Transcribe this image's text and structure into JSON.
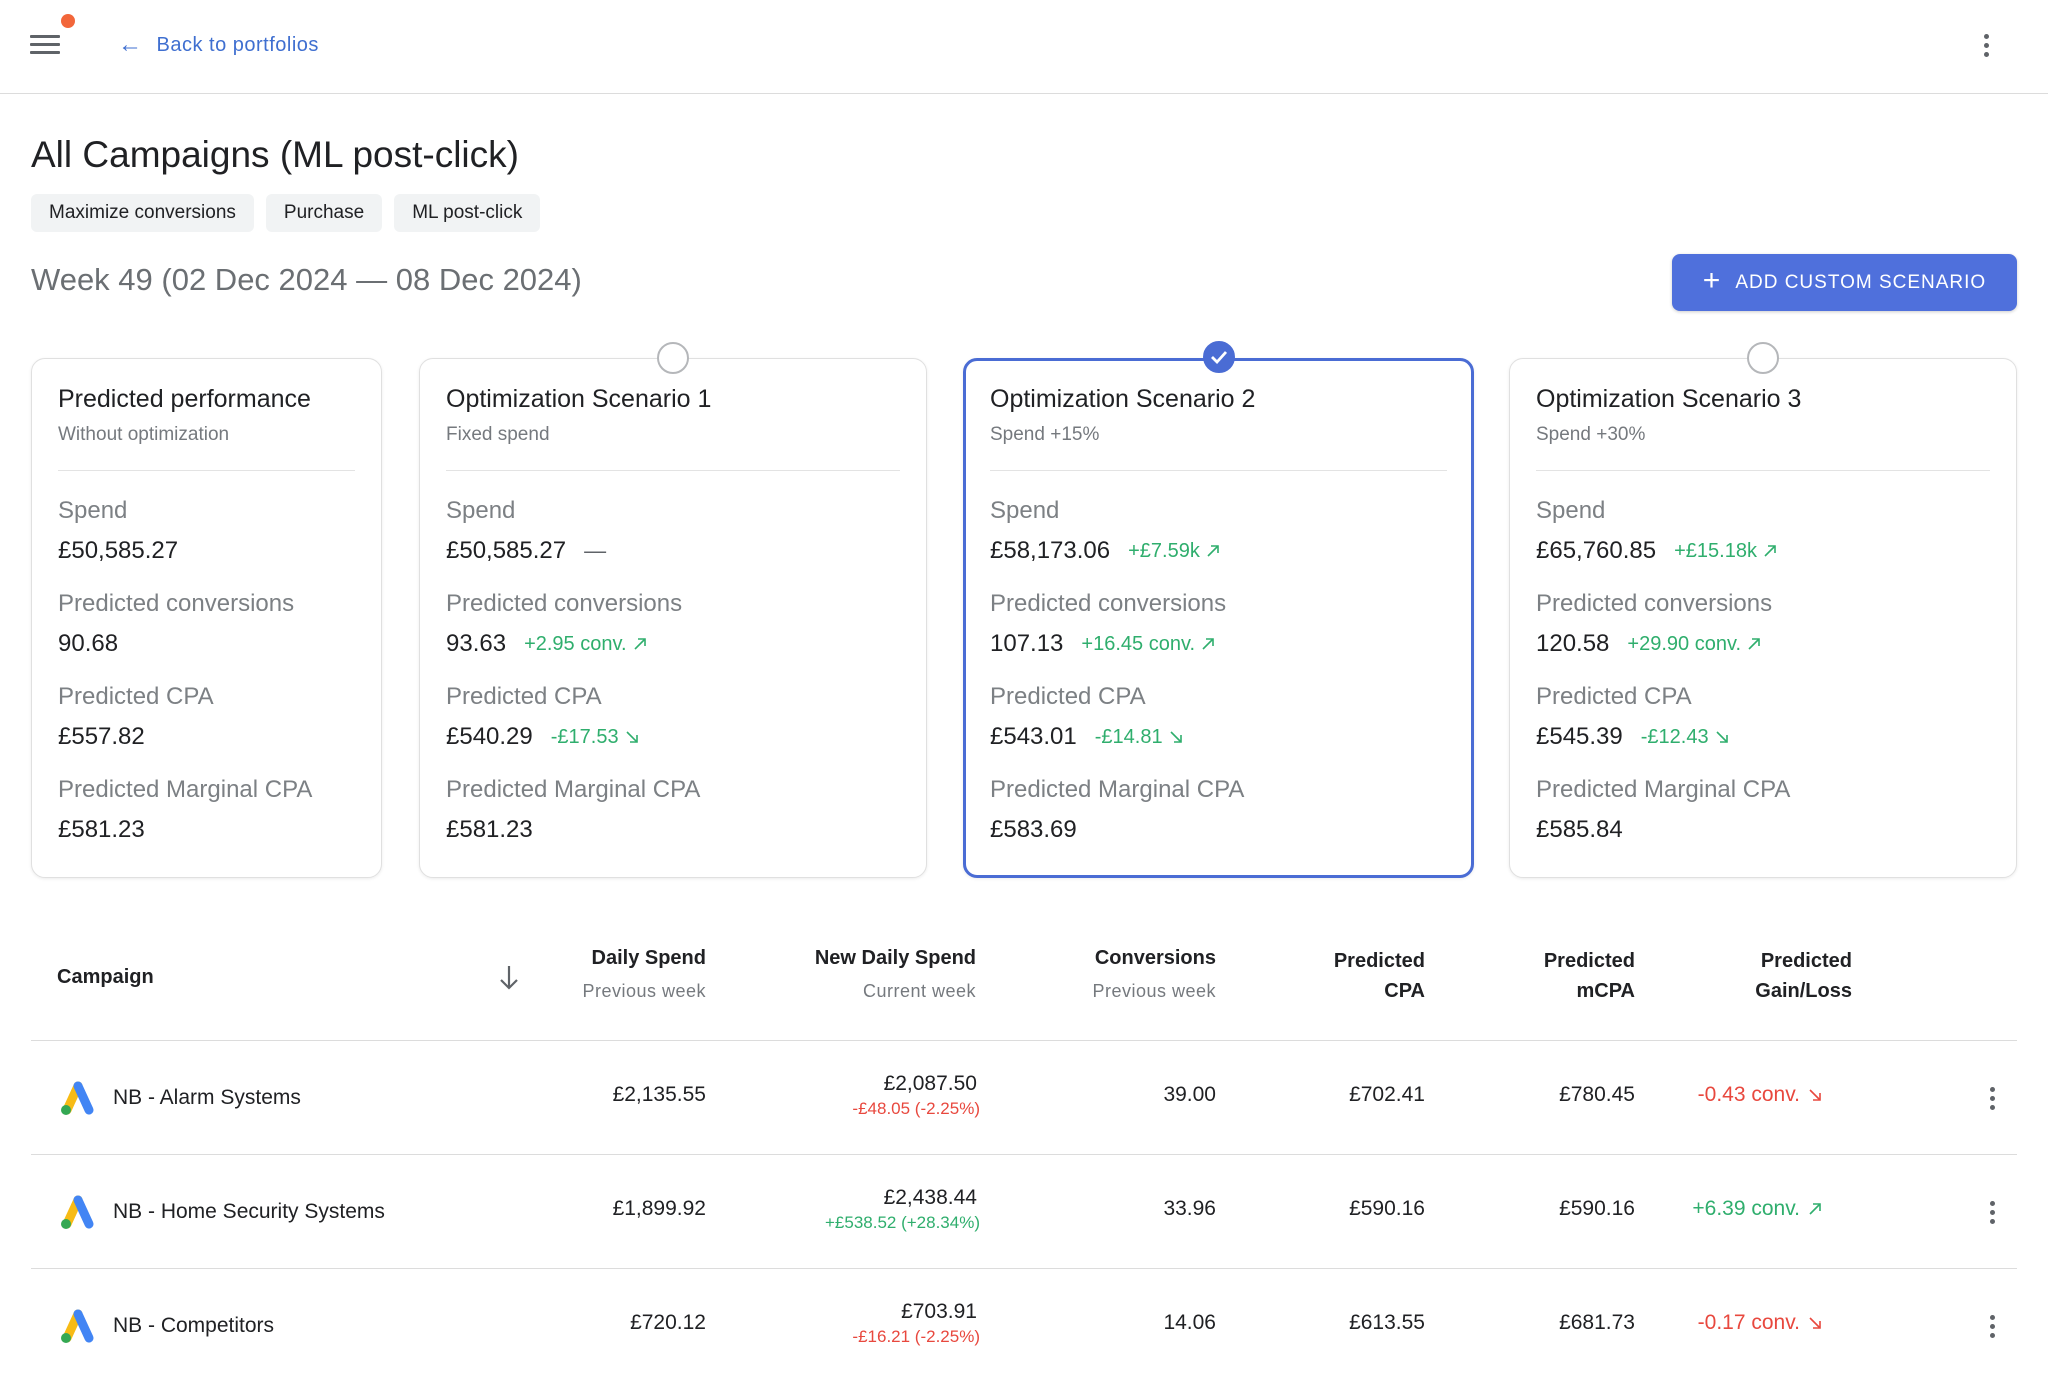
{
  "topbar": {
    "menu_icon": "hamburger-menu-icon",
    "notification_color": "#f2663a",
    "back_label": "Back to portfolios",
    "back_icon": "arrow-left-icon",
    "more_icon": "more-vertical-icon"
  },
  "header": {
    "title": "All Campaigns (ML post-click)",
    "chips": [
      "Maximize conversions",
      "Purchase",
      "ML post-click"
    ],
    "week": "Week 49 (02 Dec 2024 — 08 Dec 2024)",
    "add_button": "ADD CUSTOM SCENARIO",
    "add_button_color": "#4f70dc"
  },
  "labels": {
    "spend": "Spend",
    "conversions": "Predicted conversions",
    "cpa": "Predicted CPA",
    "marginal_cpa": "Predicted Marginal CPA"
  },
  "cards": [
    {
      "title": "Predicted performance",
      "subtitle": "Without optimization",
      "spend": "£50,585.27",
      "spend_delta": "",
      "conversions": "90.68",
      "conversions_delta": "",
      "cpa": "£557.82",
      "cpa_delta": "",
      "marginal_cpa": "£581.23",
      "selectable": false,
      "selected": false
    },
    {
      "title": "Optimization Scenario 1",
      "subtitle": "Fixed spend",
      "spend": "£50,585.27",
      "spend_delta": "—",
      "conversions": "93.63",
      "conversions_delta": "+2.95 conv.",
      "cpa": "£540.29",
      "cpa_delta": "-£17.53",
      "marginal_cpa": "£581.23",
      "selectable": true,
      "selected": false
    },
    {
      "title": "Optimization Scenario 2",
      "subtitle": "Spend +15%",
      "spend": "£58,173.06",
      "spend_delta": "+£7.59k",
      "conversions": "107.13",
      "conversions_delta": "+16.45 conv.",
      "cpa": "£543.01",
      "cpa_delta": "-£14.81",
      "marginal_cpa": "£583.69",
      "selectable": true,
      "selected": true
    },
    {
      "title": "Optimization Scenario 3",
      "subtitle": "Spend +30%",
      "spend": "£65,760.85",
      "spend_delta": "+£15.18k",
      "conversions": "120.58",
      "conversions_delta": "+29.90 conv.",
      "cpa": "£545.39",
      "cpa_delta": "-£12.43",
      "marginal_cpa": "£585.84",
      "selectable": true,
      "selected": false
    }
  ],
  "table": {
    "headers": {
      "campaign": "Campaign",
      "daily_spend": "Daily Spend",
      "daily_spend_sub": "Previous week",
      "new_daily_spend": "New Daily Spend",
      "new_daily_spend_sub": "Current week",
      "conversions": "Conversions",
      "conversions_sub": "Previous week",
      "predicted_cpa_1": "Predicted",
      "predicted_cpa_2": "CPA",
      "predicted_mcpa_1": "Predicted",
      "predicted_mcpa_2": "mCPA",
      "gain_1": "Predicted",
      "gain_2": "Gain/Loss"
    },
    "sort_icon": "arrow-down-icon",
    "rows": [
      {
        "name": "NB - Alarm Systems",
        "daily_spend": "£2,135.55",
        "new_daily_spend": "£2,087.50",
        "new_daily_spend_change": "-£48.05 (-2.25%)",
        "change_direction": "neg",
        "conversions": "39.00",
        "cpa": "£702.41",
        "mcpa": "£780.45",
        "gain": "-0.43 conv.",
        "gain_direction": "neg"
      },
      {
        "name": "NB - Home Security Systems",
        "daily_spend": "£1,899.92",
        "new_daily_spend": "£2,438.44",
        "new_daily_spend_change": "+£538.52 (+28.34%)",
        "change_direction": "pos",
        "conversions": "33.96",
        "cpa": "£590.16",
        "mcpa": "£590.16",
        "gain": "+6.39 conv.",
        "gain_direction": "pos"
      },
      {
        "name": "NB - Competitors",
        "daily_spend": "£720.12",
        "new_daily_spend": "£703.91",
        "new_daily_spend_change": "-£16.21 (-2.25%)",
        "change_direction": "neg",
        "conversions": "14.06",
        "cpa": "£613.55",
        "mcpa": "£681.73",
        "gain": "-0.17 conv.",
        "gain_direction": "neg"
      }
    ]
  },
  "colors": {
    "positive": "#2fae6d",
    "negative": "#e8483e",
    "accent": "#4a6cd4"
  }
}
